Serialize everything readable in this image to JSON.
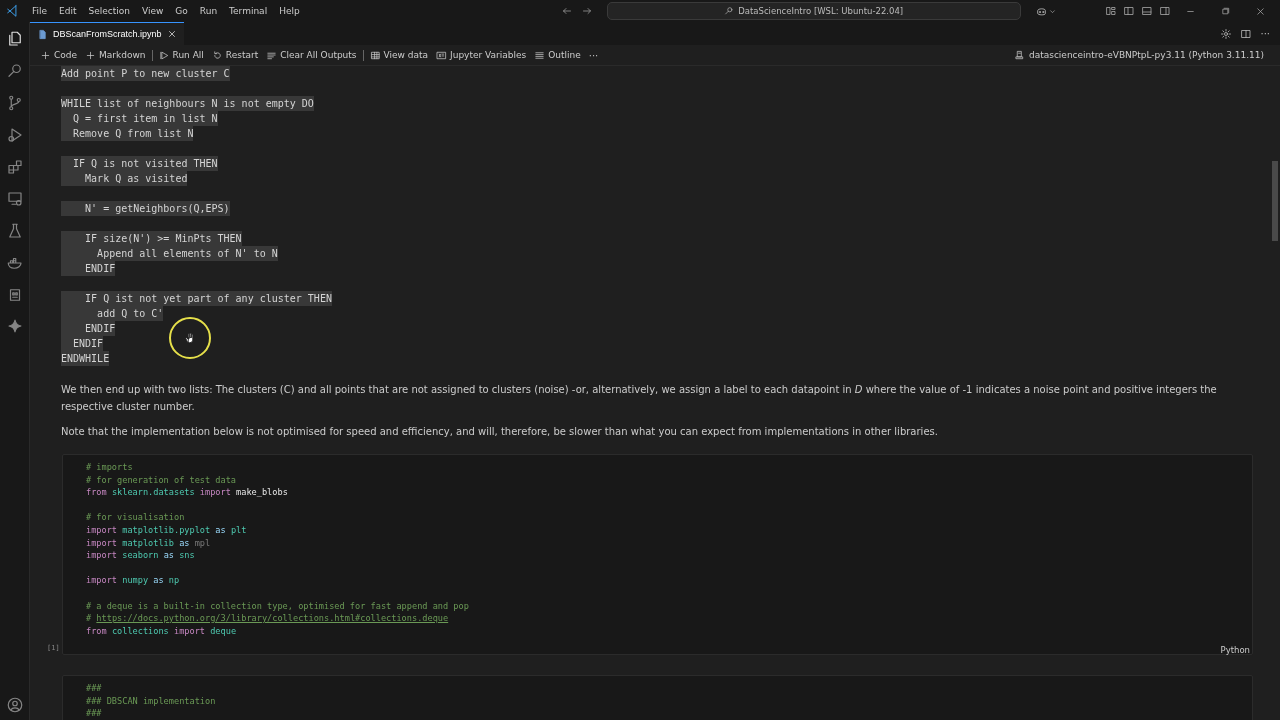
{
  "title_bar": {
    "menus": [
      "File",
      "Edit",
      "Selection",
      "View",
      "Go",
      "Run",
      "Terminal",
      "Help"
    ],
    "command_center": "DataScienceIntro [WSL: Ubuntu-22.04]"
  },
  "editor_tabs": [
    {
      "label": "DBScanFromScratch.ipynb",
      "selected": true
    }
  ],
  "editor_actions_more": "···",
  "toolbar": {
    "items": [
      {
        "kind": "add",
        "label": "Code",
        "separator_before": false
      },
      {
        "kind": "add",
        "label": "Markdown",
        "separator_before": false
      },
      {
        "kind": "run",
        "label": "Run All",
        "separator_before": true
      },
      {
        "kind": "restart",
        "label": "Restart",
        "separator_before": false
      },
      {
        "kind": "clear",
        "label": "Clear All Outputs",
        "separator_before": false
      },
      {
        "kind": "data",
        "label": "View data",
        "separator_before": true
      },
      {
        "kind": "variables",
        "label": "Jupyter Variables",
        "separator_before": false
      },
      {
        "kind": "outline",
        "label": "Outline",
        "separator_before": false
      }
    ],
    "more": "···",
    "kernel": "datascienceintro-eVBNPtpL-py3.11 (Python 3.11.11)"
  },
  "markdown_cell": {
    "pseudocode": [
      [
        "Add point P to new cluster C"
      ],
      [
        "WHILE list of neighbours N is not empty DO",
        "  Q = first item in list N",
        "  Remove Q from list N"
      ],
      [
        "  IF Q is not visited THEN",
        "    Mark Q as visited"
      ],
      [
        "    N' = getNeighbors(Q,EPS)"
      ],
      [
        "    IF size(N') >= MinPts THEN",
        "      Append all elements of N' to N",
        "    ENDIF"
      ],
      [
        "    IF Q ist not yet part of any cluster THEN",
        "      add Q to C'",
        "    ENDIF",
        "  ENDIF",
        "ENDWHILE"
      ]
    ],
    "paragraphs": [
      "We then end up with two lists: The clusters (C) and all points that are not assigned to clusters (noise) -or, alternatively, we assign a label to each datapoint in *D* where the value of -1 indicates a noise point and positive integers the respective cluster number.",
      "Note that the implementation below is not optimised for speed and efficiency, and will, therefore, be slower than what you can expect from implementations in other libraries."
    ]
  },
  "code_cells": [
    {
      "execution_count": "[1]",
      "language": "Python",
      "blocks": [
        [
          [
            {
              "t": "# imports",
              "kind": "comment"
            }
          ],
          [
            {
              "t": "# for generation of test data",
              "kind": "comment"
            }
          ],
          [
            {
              "t": "from",
              "kind": "kw"
            },
            {
              "t": " sklearn.datasets",
              "kind": "mod"
            },
            {
              "t": " import",
              "kind": "kw"
            },
            {
              "t": " make_blobs",
              "kind": "name"
            }
          ]
        ],
        [
          [
            {
              "t": "# for visualisation",
              "kind": "comment"
            }
          ],
          [
            {
              "t": "import",
              "kind": "kw"
            },
            {
              "t": " matplotlib.pyplot",
              "kind": "mod"
            },
            {
              "t": " as",
              "kind": "as"
            },
            {
              "t": " plt",
              "kind": "mod"
            }
          ],
          [
            {
              "t": "import",
              "kind": "kw"
            },
            {
              "t": " matplotlib",
              "kind": "mod"
            },
            {
              "t": " as",
              "kind": "as"
            },
            {
              "t": " mpl",
              "kind": "unused"
            }
          ],
          [
            {
              "t": "import",
              "kind": "kw"
            },
            {
              "t": " seaborn",
              "kind": "mod"
            },
            {
              "t": " as",
              "kind": "as"
            },
            {
              "t": " sns",
              "kind": "mod"
            }
          ]
        ],
        [
          [
            {
              "t": "import",
              "kind": "kw"
            },
            {
              "t": " numpy",
              "kind": "mod"
            },
            {
              "t": " as",
              "kind": "as"
            },
            {
              "t": " np",
              "kind": "mod"
            }
          ]
        ],
        [
          [
            {
              "t": "# a deque is a built-in collection type, optimised for fast append and pop",
              "kind": "comment"
            }
          ],
          [
            {
              "t": "# ",
              "kind": "comment"
            },
            {
              "t": "https://docs.python.org/3/library/collections.html#collections.deque",
              "kind": "link"
            }
          ],
          [
            {
              "t": "from",
              "kind": "kw"
            },
            {
              "t": " collections",
              "kind": "mod"
            },
            {
              "t": " import",
              "kind": "kw"
            },
            {
              "t": " deque",
              "kind": "mod"
            }
          ]
        ]
      ]
    },
    {
      "blocks": [
        [
          [
            {
              "t": "###",
              "kind": "comment"
            }
          ],
          [
            {
              "t": "### DBSCAN implementation",
              "kind": "comment"
            }
          ],
          [
            {
              "t": "###",
              "kind": "comment"
            }
          ]
        ]
      ]
    }
  ]
}
